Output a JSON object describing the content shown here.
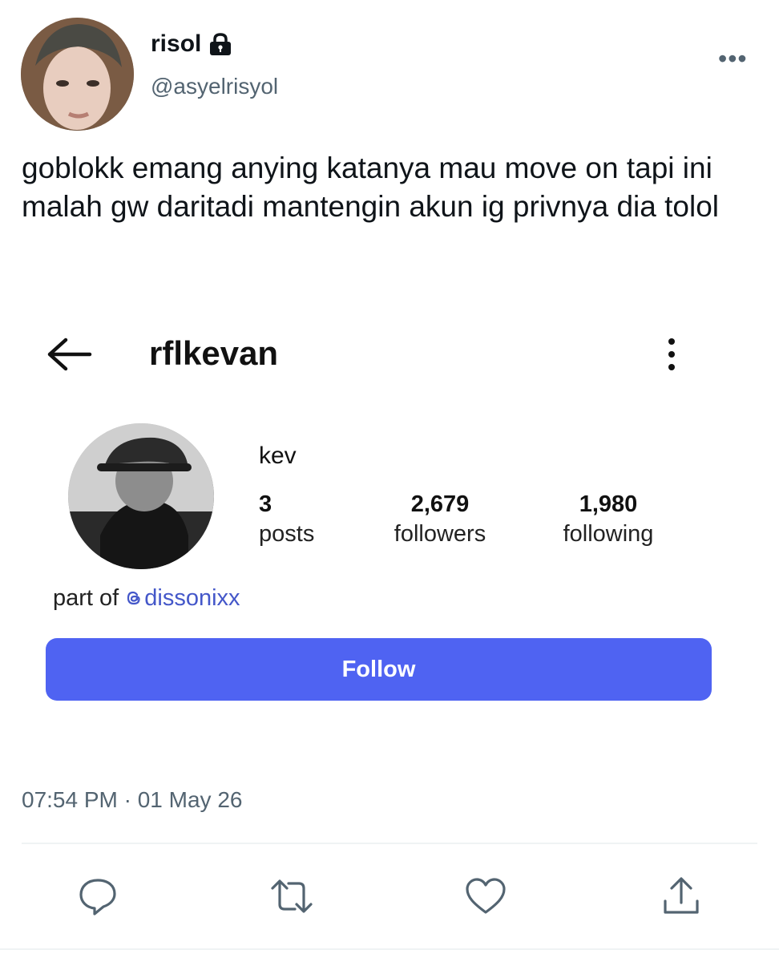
{
  "tweet": {
    "author": {
      "display_name": "risol",
      "handle": "@asyelrisyol",
      "protected_icon": "lock-icon",
      "avatar_icon": "avatar-photo"
    },
    "more_icon": "more-horizontal-icon",
    "more_glyph": "•••",
    "text": "goblokk emang anying katanya mau move on tapi ini malah gw daritadi mantengin akun ig privnya dia tolol",
    "timestamp": "07:54 PM · 01 May 26",
    "actions": [
      "reply-icon",
      "retweet-icon",
      "like-icon",
      "share-icon"
    ]
  },
  "instagram": {
    "username": "rflkevan",
    "name": "kev",
    "stats": {
      "posts": {
        "value": "3",
        "label": "posts"
      },
      "followers": {
        "value": "2,679",
        "label": "followers"
      },
      "following": {
        "value": "1,980",
        "label": "following"
      }
    },
    "bio": {
      "prefix": "part of ",
      "mention": "dissonixx"
    },
    "follow_label": "Follow"
  },
  "colors": {
    "follow_button": "#4f63f2",
    "mention": "#4457c9",
    "secondary_text": "#536471"
  }
}
